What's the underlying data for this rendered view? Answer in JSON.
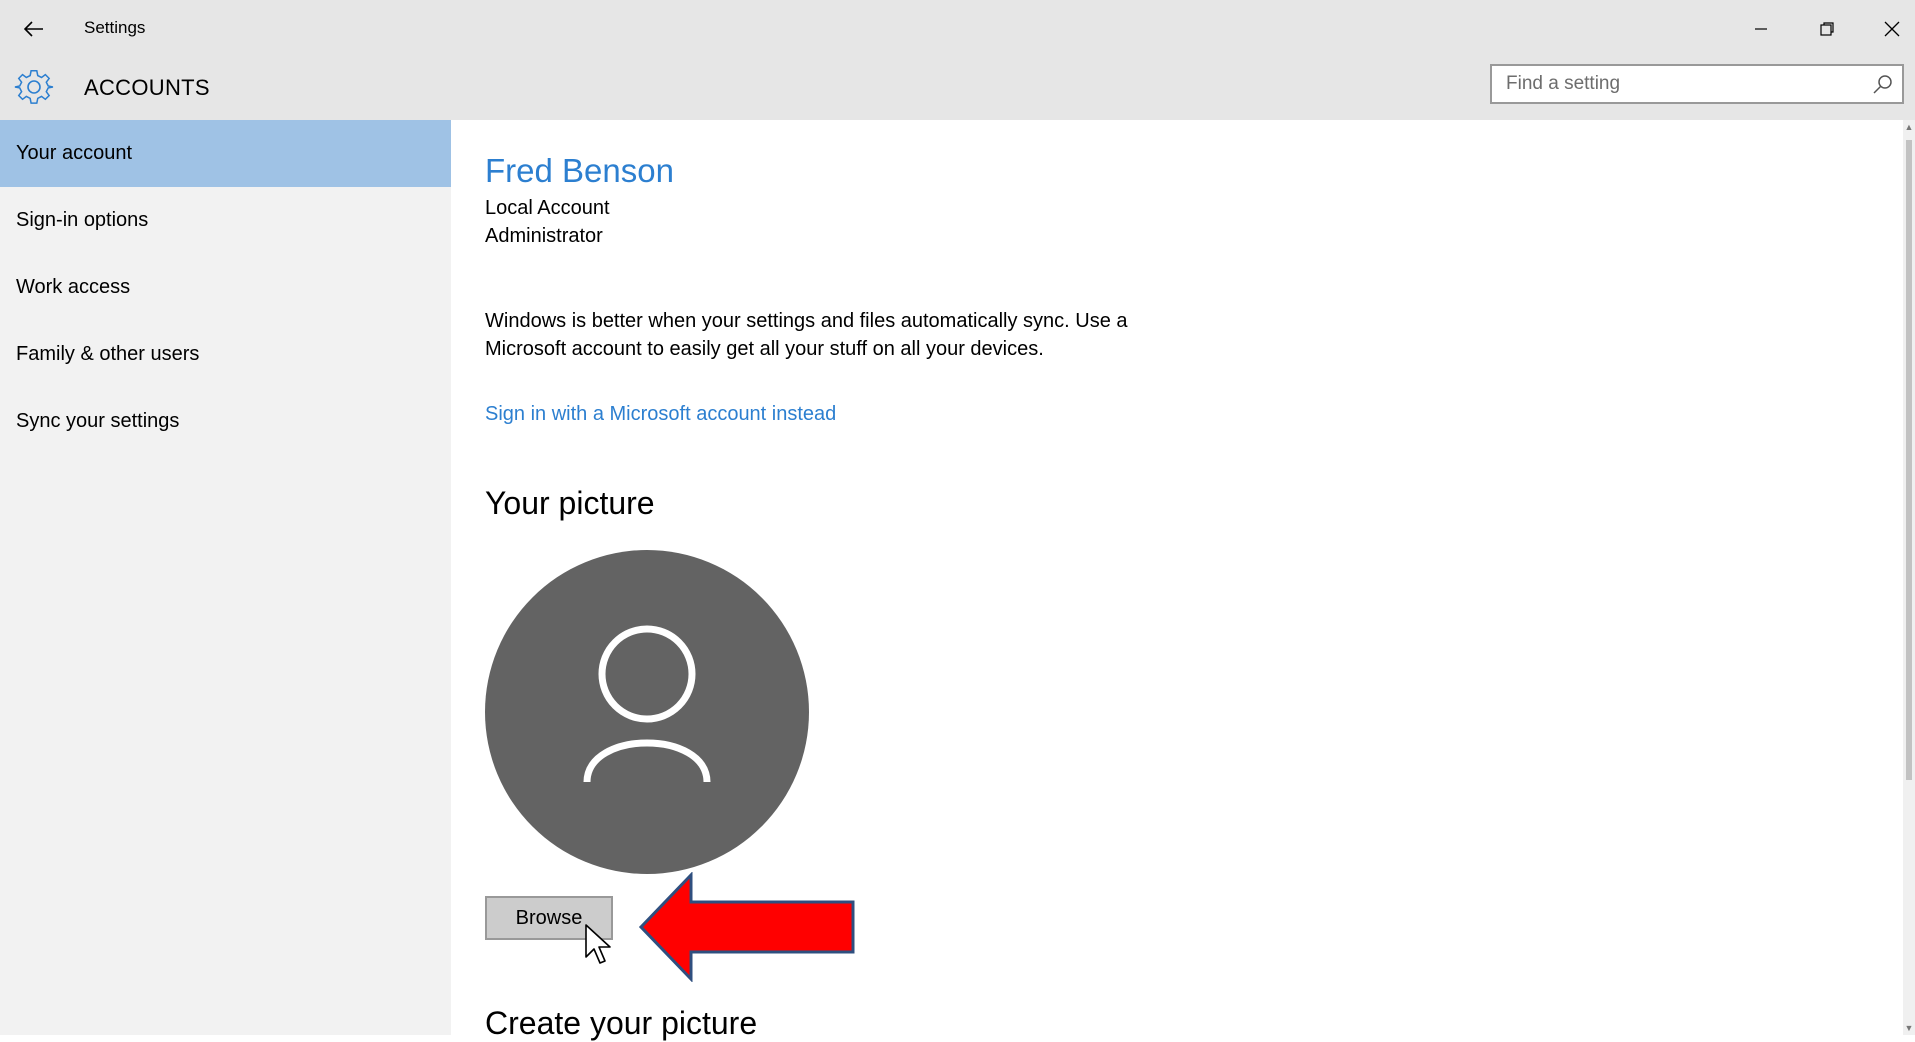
{
  "window": {
    "title": "Settings"
  },
  "header": {
    "title": "ACCOUNTS",
    "search_placeholder": "Find a setting"
  },
  "sidebar": {
    "items": [
      {
        "label": "Your account",
        "active": true
      },
      {
        "label": "Sign-in options"
      },
      {
        "label": "Work access"
      },
      {
        "label": "Family & other users"
      },
      {
        "label": "Sync your settings"
      }
    ]
  },
  "main": {
    "user_name": "Fred Benson",
    "account_type": "Local Account",
    "account_role": "Administrator",
    "sync_message": "Windows is better when your settings and files automatically sync. Use a Microsoft account to easily get all your stuff on all your devices.",
    "ms_link": "Sign in with a Microsoft account instead",
    "picture_heading": "Your picture",
    "browse_label": "Browse",
    "create_heading": "Create your picture"
  },
  "colors": {
    "accent": "#2c7fd0",
    "selected_item": "#9fc2e5",
    "avatar_bg": "#636363",
    "annotation_arrow": "#ff0000"
  }
}
